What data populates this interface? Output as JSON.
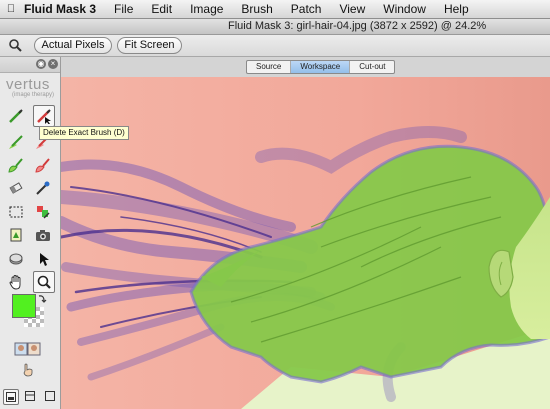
{
  "menubar": {
    "apple_icon": "apple-icon",
    "app_name": "Fluid Mask 3",
    "items": [
      "File",
      "Edit",
      "Image",
      "Brush",
      "Patch",
      "View",
      "Window",
      "Help"
    ]
  },
  "window": {
    "title": "Fluid Mask 3: girl-hair-04.jpg (3872 x 2592) @ 24.2%"
  },
  "toolbar": {
    "zoom_icon": "magnifier-icon",
    "actual_pixels": "Actual Pixels",
    "fit_screen": "Fit Screen"
  },
  "panel": {
    "logo_name": "vertus",
    "logo_sub": "image therapy",
    "tooltip": "Delete Exact Brush (D)",
    "foreground_color": "#52f020",
    "tools": [
      "keep-brush-icon",
      "delete-exact-brush-icon",
      "keep-local-brush-icon",
      "delete-local-brush-icon",
      "keep-patch-icon",
      "delete-patch-icon",
      "eraser-icon",
      "eyedropper-icon",
      "rect-select-icon",
      "patch-tool-icon",
      "cutout-icon",
      "camera-icon",
      "blend-icon",
      "pointer-icon",
      "hand-icon",
      "zoom-tool-icon"
    ],
    "bottom_icons": [
      "view-mode-1-icon",
      "view-mode-2-icon",
      "view-mode-3-icon"
    ]
  },
  "tabs": {
    "items": [
      "Source",
      "Workspace",
      "Cut-out"
    ],
    "active": "Workspace"
  },
  "colors": {
    "background_mask": "#f2a89c",
    "keep_green": "#8fd34f",
    "delete_purple": "#8a78d6",
    "selected_tab": "#a8cbf0"
  }
}
